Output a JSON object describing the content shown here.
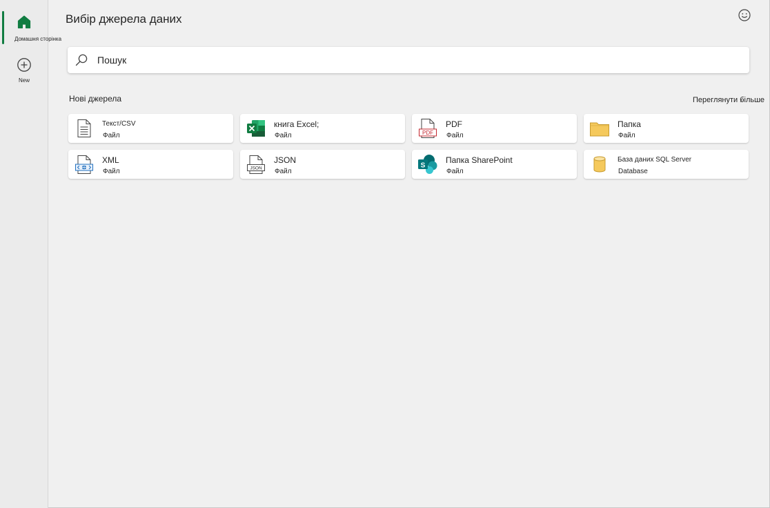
{
  "nav": {
    "home_label": "Домашня сторінка",
    "new_label": "New"
  },
  "header": {
    "title": "Вибір джерела даних"
  },
  "search": {
    "placeholder": "Пошук"
  },
  "section": {
    "title": "Нові джерела",
    "see_more": "Переглянути більше"
  },
  "sources": [
    {
      "name": "Текст/CSV",
      "type": "Файл",
      "icon": "text-file-icon"
    },
    {
      "name": "книга Excel;",
      "type": "Файл",
      "icon": "excel-icon"
    },
    {
      "name": "PDF",
      "type": "Файл",
      "icon": "pdf-icon"
    },
    {
      "name": "Папка",
      "type": "Файл",
      "icon": "folder-icon"
    },
    {
      "name": "XML",
      "type": "Файл",
      "icon": "xml-icon"
    },
    {
      "name": "JSON",
      "type": "Файл",
      "icon": "json-icon"
    },
    {
      "name": "Папка SharePoint",
      "type": "Файл",
      "icon": "sharepoint-icon"
    },
    {
      "name": "База даних SQL Server",
      "type": "Database",
      "icon": "database-icon"
    }
  ],
  "colors": {
    "accent": "#107c41",
    "excel_green": "#107c41",
    "folder": "#f5c95c",
    "pdf_red": "#c4262e",
    "sharepoint": "#036c70"
  }
}
